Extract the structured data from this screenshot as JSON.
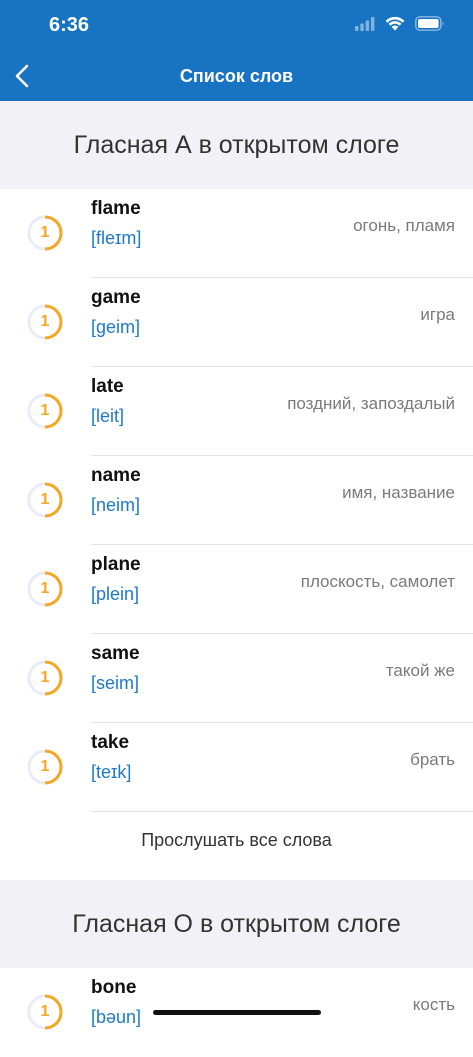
{
  "status_bar": {
    "time": "6:36"
  },
  "nav": {
    "title": "Список слов"
  },
  "colors": {
    "header": "#1874c3",
    "progress": "#f5a623",
    "transcription": "#1c7ac7"
  },
  "sections": [
    {
      "title": "Гласная А в открытом слоге",
      "words": [
        {
          "count": "1",
          "word": "flame",
          "transcription": "[fleɪm]",
          "translation": "огонь, пламя"
        },
        {
          "count": "1",
          "word": "game",
          "transcription": "[geim]",
          "translation": "игра"
        },
        {
          "count": "1",
          "word": "late",
          "transcription": "[leit]",
          "translation": "поздний, запоздалый"
        },
        {
          "count": "1",
          "word": "name",
          "transcription": "[neim]",
          "translation": "имя, название"
        },
        {
          "count": "1",
          "word": "plane",
          "transcription": "[plein]",
          "translation": "плоскость, самолет"
        },
        {
          "count": "1",
          "word": "same",
          "transcription": "[seim]",
          "translation": "такой же"
        },
        {
          "count": "1",
          "word": "take",
          "transcription": "[teɪk]",
          "translation": "брать"
        }
      ],
      "listen_all": "Прослушать все слова"
    },
    {
      "title": "Гласная О в открытом слоге",
      "words": [
        {
          "count": "1",
          "word": "bone",
          "transcription": "[bəun]",
          "translation": "кость"
        }
      ]
    }
  ]
}
